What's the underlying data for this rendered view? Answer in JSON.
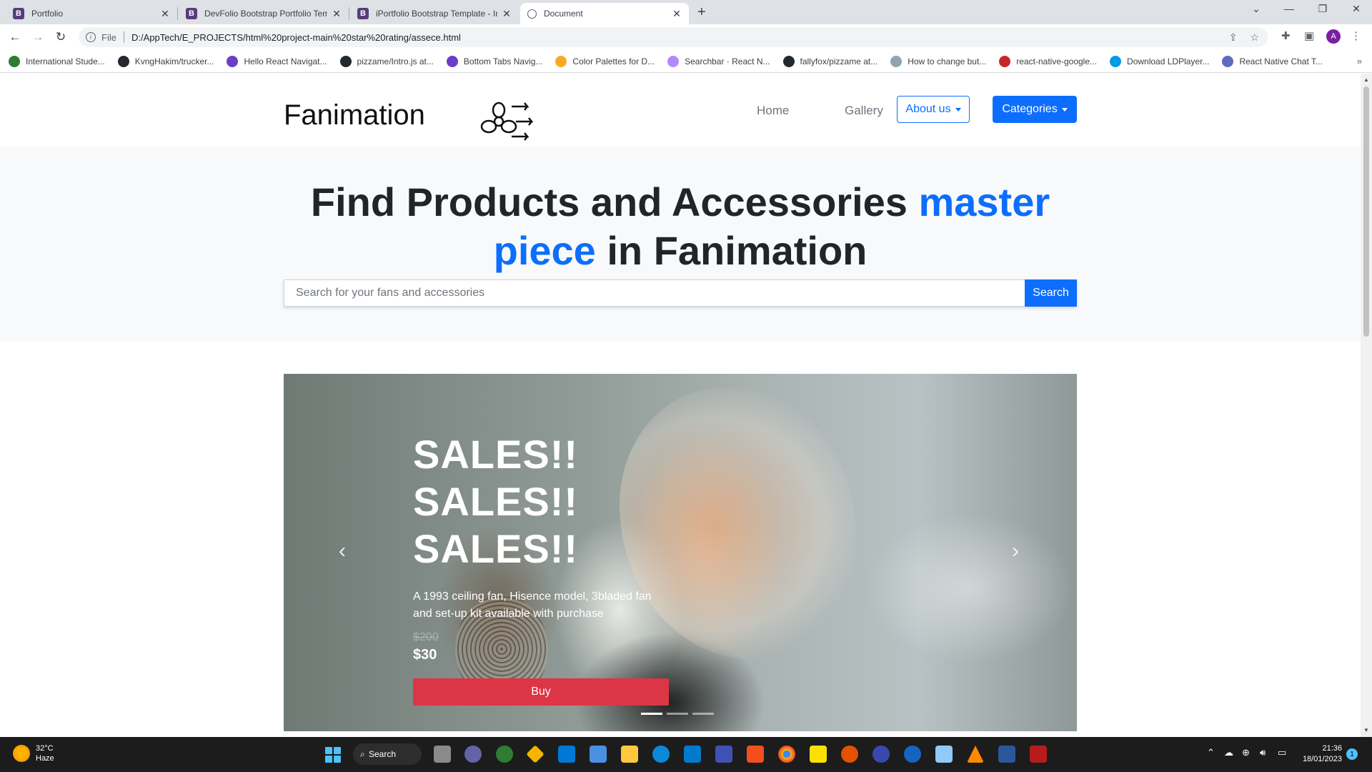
{
  "browser": {
    "tabs": [
      {
        "title": "Portfolio",
        "favicon": "B"
      },
      {
        "title": "DevFolio Bootstrap Portfolio Tem",
        "favicon": "B"
      },
      {
        "title": "iPortfolio Bootstrap Template - In",
        "favicon": "B"
      },
      {
        "title": "Document",
        "favicon": ""
      }
    ],
    "address": {
      "scheme_label": "File",
      "url": "D:/AppTech/E_PROJECTS/html%20project-main%20star%20rating/assece.html"
    },
    "profile_initial": "A",
    "bookmarks": [
      {
        "label": "International Stude...",
        "color": "#2e7d32"
      },
      {
        "label": "KvngHakim/trucker...",
        "color": "#24292f"
      },
      {
        "label": "Hello React Navigat...",
        "color": "#6a3fc7"
      },
      {
        "label": "pizzame/Intro.js at...",
        "color": "#24292f"
      },
      {
        "label": "Bottom Tabs Navig...",
        "color": "#6a3fc7"
      },
      {
        "label": "Color Palettes for D...",
        "color": "#f9a825"
      },
      {
        "label": "Searchbar · React N...",
        "color": "#b388ff"
      },
      {
        "label": "fallyfox/pizzame at...",
        "color": "#24292f"
      },
      {
        "label": "How to change but...",
        "color": "#90a4ae"
      },
      {
        "label": "react-native-google...",
        "color": "#c62828"
      },
      {
        "label": "Download LDPlayer...",
        "color": "#039be5"
      },
      {
        "label": "React Native Chat T...",
        "color": "#5c6bc0"
      }
    ]
  },
  "site": {
    "brand": "Fanimation",
    "nav": {
      "home": "Home",
      "gallery": "Gallery",
      "about": "About us",
      "categories": "Categories"
    },
    "hero": {
      "title_part1": "Find Products and Accessories ",
      "title_accent": "master piece",
      "title_part2": " in Fanimation",
      "search_placeholder": "Search for your fans and accessories",
      "search_button": "Search"
    },
    "carousel": {
      "headline": [
        "SALES!!",
        "SALES!!",
        "SALES!!"
      ],
      "description": "A 1993 ceiling fan, Hisence model, 3bladed fan and set-up kit available with purchase",
      "old_price": "$200",
      "price": "$30",
      "buy_label": "Buy",
      "active_slide": 1,
      "slide_count": 3
    },
    "colors": {
      "primary": "#0d6efd",
      "danger": "#dc3545"
    }
  },
  "taskbar": {
    "weather_temp": "32°C",
    "weather_desc": "Haze",
    "search_label": "Search",
    "time": "21:36",
    "date": "18/01/2023",
    "notification_count": "1"
  }
}
